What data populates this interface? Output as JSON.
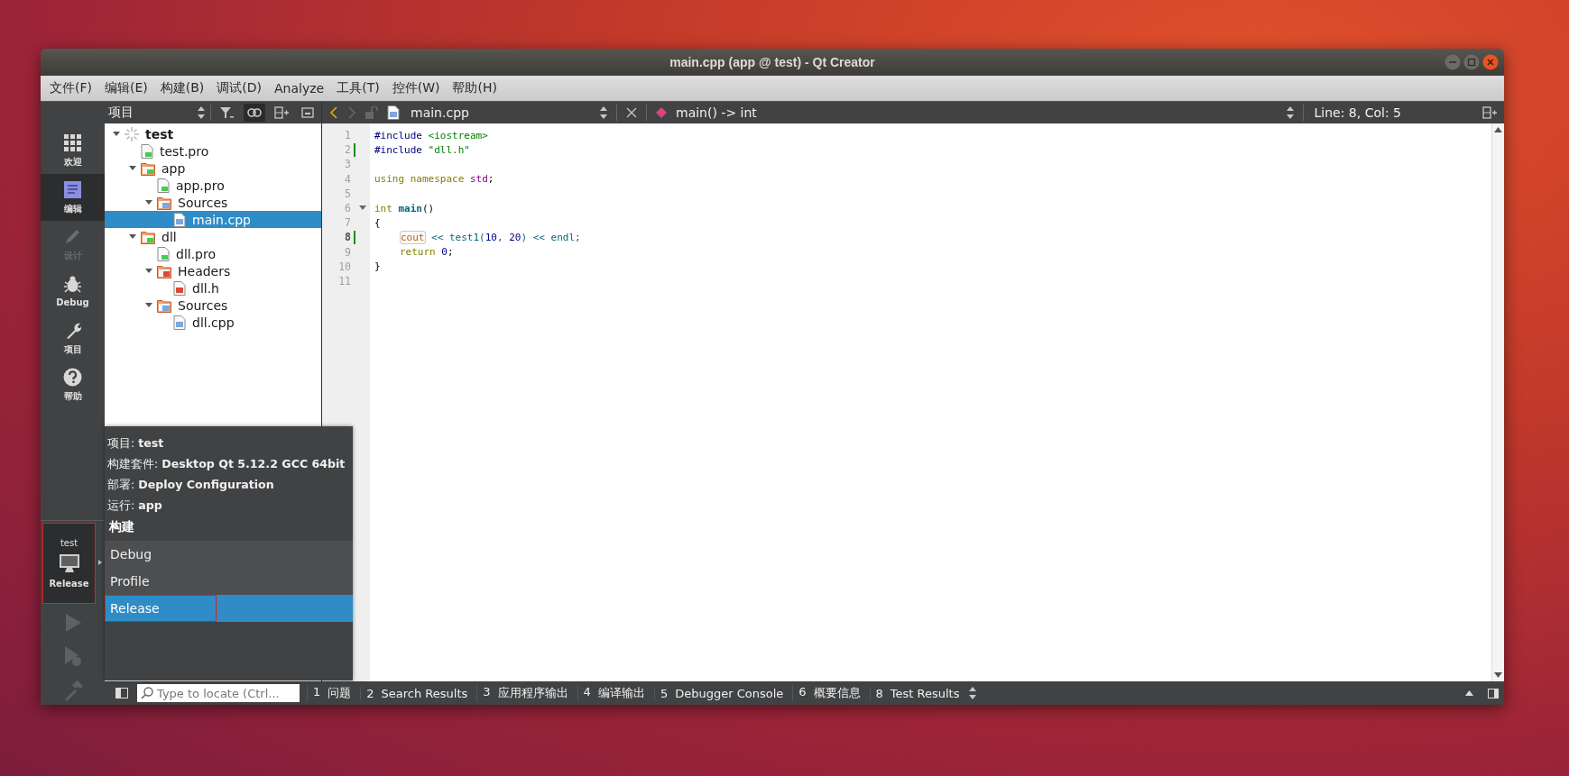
{
  "window": {
    "title": "main.cpp (app @ test) - Qt Creator"
  },
  "menu": [
    "文件(F)",
    "编辑(E)",
    "构建(B)",
    "调试(D)",
    "Analyze",
    "工具(T)",
    "控件(W)",
    "帮助(H)"
  ],
  "modes": [
    {
      "label": "欢迎",
      "kind": "welcome",
      "selected": false,
      "disabled": false
    },
    {
      "label": "编辑",
      "kind": "edit",
      "selected": true,
      "disabled": false
    },
    {
      "label": "设计",
      "kind": "design",
      "selected": false,
      "disabled": true
    },
    {
      "label": "Debug",
      "kind": "debug",
      "selected": false,
      "disabled": false
    },
    {
      "label": "项目",
      "kind": "projects",
      "selected": false,
      "disabled": false
    },
    {
      "label": "帮助",
      "kind": "help",
      "selected": false,
      "disabled": false
    }
  ],
  "kit_selector": {
    "project": "test",
    "build": "Release",
    "annotated": true
  },
  "project_pane": {
    "title": "项目"
  },
  "tree": [
    {
      "label": "test",
      "kind": "project",
      "expanded": true,
      "selected": false,
      "children": [
        {
          "label": "test.pro",
          "kind": "pro",
          "selected": false
        },
        {
          "label": "app",
          "kind": "folder",
          "expanded": true,
          "selected": false,
          "children": [
            {
              "label": "app.pro",
              "kind": "pro",
              "selected": false
            },
            {
              "label": "Sources",
              "kind": "folder-src",
              "expanded": true,
              "selected": false,
              "children": [
                {
                  "label": "main.cpp",
                  "kind": "cpp",
                  "selected": true
                }
              ]
            }
          ]
        },
        {
          "label": "dll",
          "kind": "folder",
          "expanded": true,
          "selected": false,
          "children": [
            {
              "label": "dll.pro",
              "kind": "pro",
              "selected": false
            },
            {
              "label": "Headers",
              "kind": "folder-hdr",
              "expanded": true,
              "selected": false,
              "children": [
                {
                  "label": "dll.h",
                  "kind": "h",
                  "selected": false
                }
              ]
            },
            {
              "label": "Sources",
              "kind": "folder-src",
              "expanded": true,
              "selected": false,
              "children": [
                {
                  "label": "dll.cpp",
                  "kind": "cpp",
                  "selected": false
                }
              ]
            }
          ]
        }
      ]
    }
  ],
  "editor": {
    "file": "main.cpp",
    "symbol": "main() -> int",
    "position": "Line: 8, Col: 5"
  },
  "code": [
    {
      "number": "1",
      "modified": false,
      "current": false,
      "fold": false,
      "indented": false,
      "tokens": [
        {
          "text": "#include ",
          "kind": "pre"
        },
        {
          "text": "<iostream>",
          "kind": "str"
        }
      ]
    },
    {
      "number": "2",
      "modified": true,
      "current": false,
      "fold": false,
      "indented": false,
      "tokens": [
        {
          "text": "#include ",
          "kind": "pre"
        },
        {
          "text": "\"dll.h\"",
          "kind": "str"
        }
      ]
    },
    {
      "number": "3",
      "modified": false,
      "current": false,
      "fold": false
    },
    {
      "number": "4",
      "modified": false,
      "current": false,
      "fold": false,
      "indented": false,
      "tokens": [
        {
          "text": "using namespace ",
          "kind": "kw"
        },
        {
          "text": "std",
          "kind": "ns"
        },
        {
          "text": ";",
          "kind": "plain"
        }
      ]
    },
    {
      "number": "5",
      "modified": false,
      "current": false,
      "fold": false
    },
    {
      "number": "6",
      "modified": false,
      "current": false,
      "fold": true,
      "indented": false,
      "tokens": [
        {
          "text": "int ",
          "kind": "kw"
        },
        {
          "text": "main",
          "kind": "fn"
        },
        {
          "text": "()",
          "kind": "plain"
        }
      ]
    },
    {
      "number": "7",
      "modified": false,
      "current": false,
      "fold": false,
      "indented": false,
      "tokens": [
        {
          "text": "{",
          "kind": "plain"
        }
      ]
    },
    {
      "number": "8",
      "modified": true,
      "current": true,
      "fold": false,
      "indented": true,
      "tokens": [
        {
          "text": "cout",
          "kind": "hl"
        },
        {
          "text": " << test1(",
          "kind": "call"
        },
        {
          "text": "10",
          "kind": "num"
        },
        {
          "text": ", ",
          "kind": "call"
        },
        {
          "text": "20",
          "kind": "num"
        },
        {
          "text": ") << endl;",
          "kind": "call"
        }
      ]
    },
    {
      "number": "9",
      "modified": false,
      "current": false,
      "fold": false,
      "indented": true,
      "tokens": [
        {
          "text": "return ",
          "kind": "kw"
        },
        {
          "text": "0",
          "kind": "num"
        },
        {
          "text": ";",
          "kind": "plain"
        }
      ]
    },
    {
      "number": "10",
      "modified": false,
      "current": false,
      "fold": false,
      "indented": false,
      "tokens": [
        {
          "text": "}",
          "kind": "plain"
        }
      ]
    },
    {
      "number": "11",
      "modified": false,
      "current": false,
      "fold": false
    }
  ],
  "popup": {
    "info": [
      "项目: **test**",
      "构建套件: **Desktop Qt 5.12.2 GCC 64bit**",
      "部署: **Deploy Configuration**",
      "运行: **app**"
    ],
    "section": "构建",
    "items": [
      {
        "label": "Debug",
        "selected": false,
        "annotated": false
      },
      {
        "label": "Profile",
        "selected": false,
        "annotated": false
      },
      {
        "label": "Release",
        "selected": true,
        "annotated": true
      }
    ]
  },
  "locator": {
    "placeholder": "Type to locate (Ctrl..."
  },
  "output_tabs": [
    {
      "number": "1",
      "label": "问题"
    },
    {
      "number": "2",
      "label": "Search Results"
    },
    {
      "number": "3",
      "label": "应用程序输出"
    },
    {
      "number": "4",
      "label": "编译输出"
    },
    {
      "number": "5",
      "label": "Debugger Console"
    },
    {
      "number": "6",
      "label": "概要信息"
    },
    {
      "number": "8",
      "label": "Test Results"
    }
  ]
}
